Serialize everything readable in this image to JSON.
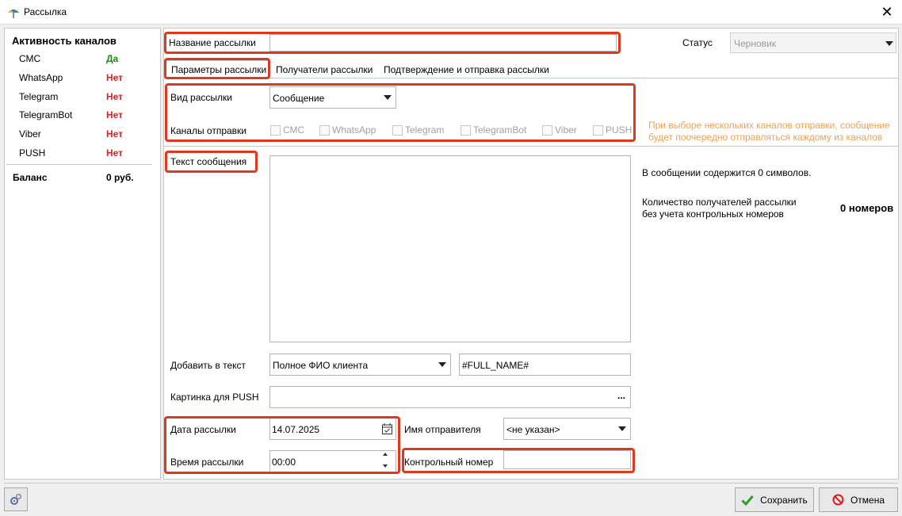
{
  "window": {
    "title": "Рассылка"
  },
  "left_panel": {
    "heading": "Активность каналов",
    "channels": [
      {
        "name": "СМС",
        "status": "Да",
        "active": true
      },
      {
        "name": "WhatsApp",
        "status": "Нет",
        "active": false
      },
      {
        "name": "Telegram",
        "status": "Нет",
        "active": false
      },
      {
        "name": "TelegramBot",
        "status": "Нет",
        "active": false
      },
      {
        "name": "Viber",
        "status": "Нет",
        "active": false
      },
      {
        "name": "PUSH",
        "status": "Нет",
        "active": false
      }
    ],
    "balance_label": "Баланс",
    "balance_value": "0 руб."
  },
  "form": {
    "name_label": "Название рассылки",
    "name_value": "",
    "status_label": "Статус",
    "status_value": "Черновик",
    "tabs": [
      {
        "label": "Параметры рассылки",
        "active": true
      },
      {
        "label": "Получатели рассылки",
        "active": false
      },
      {
        "label": "Подтверждение и отправка рассылки",
        "active": false
      }
    ],
    "type_label": "Вид рассылки",
    "type_value": "Сообщение",
    "channels_label": "Каналы отправки",
    "send_channels": [
      "СМС",
      "WhatsApp",
      "Telegram",
      "TelegramBot",
      "Viber",
      "PUSH"
    ],
    "channels_hint_line1": "При выборе нескольких каналов отправки, сообщение",
    "channels_hint_line2": "будет поочередно отправляться каждому из каналов",
    "text_label": "Текст сообщения",
    "text_value": "",
    "char_count_text": "В сообщении содержится 0 символов.",
    "recipients_line1": "Количество получателей рассылки",
    "recipients_line2": "без учета контрольных номеров",
    "recipients_count": "0 номеров",
    "add_text_label": "Добавить в текст",
    "add_text_value": "Полное ФИО клиента",
    "add_text_tag": "#FULL_NAME#",
    "push_image_label": "Картинка для PUSH",
    "push_image_value": "",
    "browse_label": "...",
    "date_label": "Дата рассылки",
    "date_value": "14.07.2025",
    "time_label": "Время рассылки",
    "time_value": "00:00",
    "sender_label": "Имя отправителя",
    "sender_value": "<не указан>",
    "control_label": "Контрольный номер",
    "control_value": ""
  },
  "footer": {
    "save_label": "Сохранить",
    "cancel_label": "Отмена"
  },
  "colors": {
    "active": "#1c8a1c",
    "inactive": "#e02020",
    "hint": "#f0a050",
    "highlight": "#e0381c"
  }
}
